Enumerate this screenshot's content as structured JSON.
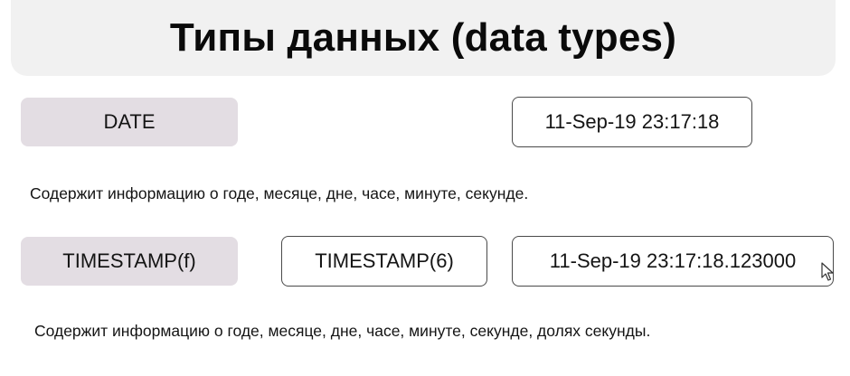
{
  "title": "Типы данных (data types)",
  "date_row": {
    "type_label": "DATE",
    "example_value": "11-Sep-19 23:17:18",
    "description": "Содержит информацию о годе, месяце, дне, часе, минуте, секунде."
  },
  "timestamp_row": {
    "type_label": "TIMESTAMP(f)",
    "example_type": "TIMESTAMP(6)",
    "example_value": "11-Sep-19 23:17:18.123000",
    "description": "Содержит информацию о годе, месяце, дне, часе, минуте, секунде, долях секунды."
  },
  "icons": {
    "cursor": "mouse-pointer-icon"
  }
}
